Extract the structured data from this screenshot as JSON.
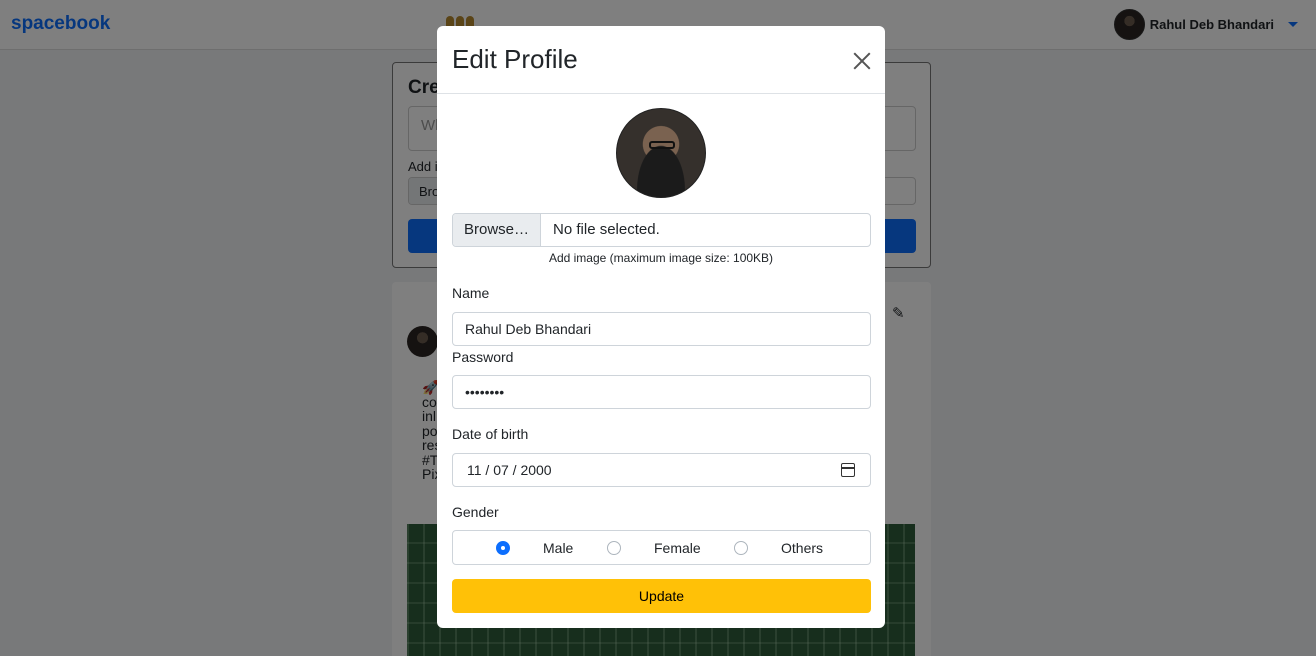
{
  "navbar": {
    "brand": "spacebook",
    "user_name": "Rahul Deb Bhandari"
  },
  "background": {
    "create_post": {
      "title": "Cre",
      "textarea_placeholder": "Wh",
      "add_label": "Add i",
      "browse_label": "Bro"
    },
    "post": {
      "text": "🚀 co inl po res #T Pix"
    }
  },
  "modal": {
    "title": "Edit Profile",
    "file": {
      "browse_label": "Browse…",
      "status": "No file selected.",
      "help": "Add image (maximum image size: 100KB)"
    },
    "name": {
      "label": "Name",
      "value": "Rahul Deb Bhandari"
    },
    "password": {
      "label": "Password",
      "value": "••••••••"
    },
    "dob": {
      "label": "Date of birth",
      "value": "11 / 07 / 2000"
    },
    "gender": {
      "label": "Gender",
      "options": [
        "Male",
        "Female",
        "Others"
      ],
      "selected": "Male"
    },
    "submit_label": "Update"
  },
  "colors": {
    "primary": "#0d6efd",
    "update_button": "#ffc107",
    "backdrop": "rgba(0,0,0,0.5)"
  },
  "icons": {
    "close": "close-icon",
    "calendar": "calendar-icon",
    "edit": "edit-icon",
    "caret": "caret-down-icon"
  }
}
